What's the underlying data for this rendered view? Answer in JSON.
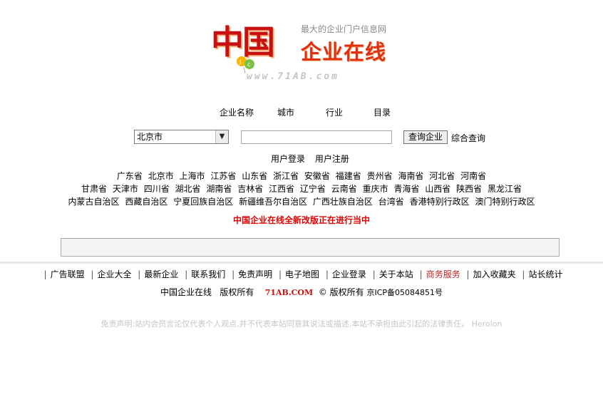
{
  "logo": {
    "chars": "中国",
    "slogan": "最大的企业门户信息网",
    "brand": "企业在线",
    "url": "www.71AB.com",
    "colors": {
      "red": "#c81010",
      "orange": "#e03010",
      "gray": "#c4c4c4"
    }
  },
  "search": {
    "tabs": [
      "企业名称",
      "城市",
      "行业",
      "目录"
    ],
    "city_selected": "北京市",
    "input_value": "",
    "button_label": "查询企业",
    "advanced_label": "综合查询"
  },
  "user": {
    "login": "用户登录",
    "register": "用户注册"
  },
  "regions": {
    "rows": [
      [
        "广东省",
        "北京市",
        "上海市",
        "江苏省",
        "山东省",
        "浙江省",
        "安徽省",
        "福建省",
        "贵州省",
        "海南省",
        "河北省",
        "河南省"
      ],
      [
        "甘肃省",
        "天津市",
        "四川省",
        "湖北省",
        "湖南省",
        "吉林省",
        "江西省",
        "辽宁省",
        "云南省",
        "重庆市",
        "青海省",
        "山西省",
        "陕西省",
        "黑龙江省"
      ],
      [
        "内蒙古自治区",
        "西藏自治区",
        "宁夏回族自治区",
        "新疆维吾尔自治区",
        "广西壮族自治区",
        "台湾省",
        "香港特别行政区",
        "澳门特别行政区"
      ]
    ]
  },
  "notice": "中国企业在线全新改版正在进行当中",
  "footer": {
    "nav": [
      {
        "label": "广告联盟",
        "highlight": false
      },
      {
        "label": "企业大全",
        "highlight": false
      },
      {
        "label": "最新企业",
        "highlight": false
      },
      {
        "label": "联系我们",
        "highlight": false
      },
      {
        "label": "免责声明",
        "highlight": false
      },
      {
        "label": "电子地图",
        "highlight": false
      },
      {
        "label": "企业登录",
        "highlight": false
      },
      {
        "label": "关于本站",
        "highlight": false
      },
      {
        "label": "商务服务",
        "highlight": true
      },
      {
        "label": "加入收藏夹",
        "highlight": false
      },
      {
        "label": "站长统计",
        "highlight": false
      }
    ],
    "site_name": "中国企业在线",
    "rights": "版权所有",
    "domain": "71AB.COM",
    "copyright_symbol": "©",
    "rights2": "版权所有",
    "icp": "京ICP备05084851号",
    "disclaimer": "免责声明:站内会员言论仅代表个人观点,并不代表本站同意其说法或描述,本站不承担由此引起的法律责任。 Herolon"
  }
}
